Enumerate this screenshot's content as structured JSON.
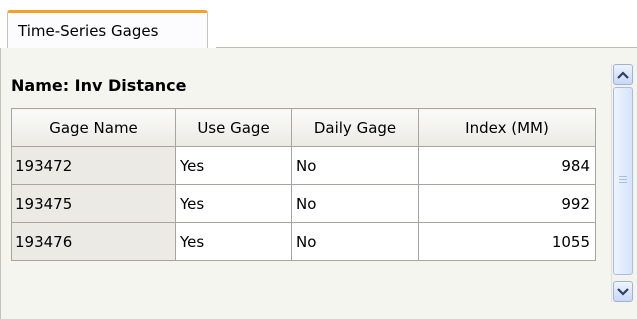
{
  "tabs": [
    {
      "label": "Time-Series Gages",
      "active": true
    }
  ],
  "panel": {
    "title": "Name: Inv Distance"
  },
  "table": {
    "columns": [
      "Gage Name",
      "Use Gage",
      "Daily Gage",
      "Index (MM)"
    ],
    "rows": [
      [
        "193472",
        "Yes",
        "No",
        "984"
      ],
      [
        "193475",
        "Yes",
        "No",
        "992"
      ],
      [
        "193476",
        "Yes",
        "No",
        "1055"
      ]
    ]
  },
  "scrollbar": {
    "up_icon": "chevron-up-icon",
    "down_icon": "chevron-down-icon"
  },
  "colors": {
    "tab_accent": "#f3a227",
    "panel_bg": "#f5f5f0",
    "grid_line": "#a8a69c"
  }
}
